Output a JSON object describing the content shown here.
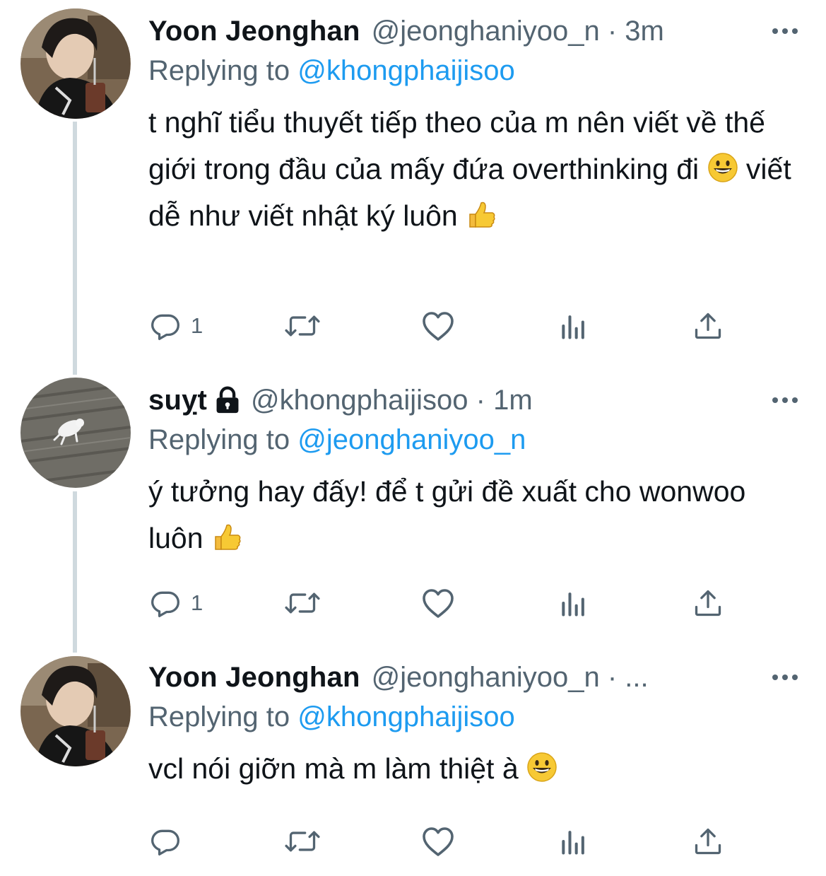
{
  "tweets": [
    {
      "name": "Yoon Jeonghan",
      "handle_time": "@jeonghaniyoo_n · 3m",
      "replying_label": "Replying to",
      "replying_to": "@khongphaijisoo",
      "text_parts": [
        "t nghĩ tiểu thuyết tiếp theo của m nên viết về thế giới trong đầu của mấy đứa overthinking đi",
        "viết dễ như viết nhật ký luôn"
      ],
      "emojis": [
        "grinning-face-emoji",
        "thumbs-up-emoji"
      ],
      "reply_count": "1",
      "locked": false
    },
    {
      "name": "suỵt",
      "handle_time": "@khongphaijisoo · 1m",
      "replying_label": "Replying to",
      "replying_to": "@jeonghaniyoo_n",
      "text_parts": [
        "ý tưởng hay đấy! để t gửi đề xuất cho wonwoo luôn"
      ],
      "emojis": [
        "thumbs-up-emoji"
      ],
      "reply_count": "1",
      "locked": true
    },
    {
      "name": "Yoon Jeonghan",
      "handle_time": "@jeonghaniyoo_n · ...",
      "replying_label": "Replying to",
      "replying_to": "@khongphaijisoo",
      "text_parts": [
        "vcl nói giỡn mà m làm thiệt à"
      ],
      "emojis": [
        "grinning-face-emoji"
      ],
      "reply_count": "",
      "locked": false
    }
  ],
  "colors": {
    "text": "#0f1419",
    "secondary": "#536471",
    "link": "#1d9bf0",
    "thread_line": "#cfd9de"
  },
  "icons": [
    "reply-icon",
    "retweet-icon",
    "like-icon",
    "views-icon",
    "share-icon",
    "more-icon",
    "lock-icon"
  ]
}
